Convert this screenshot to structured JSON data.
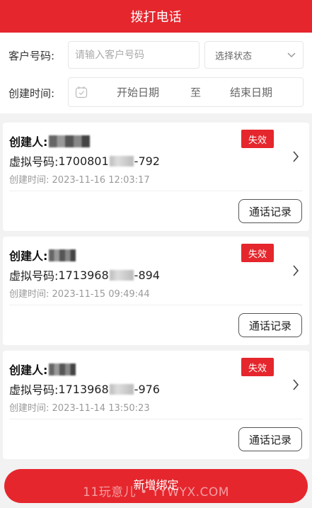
{
  "header": {
    "title": "拨打电话"
  },
  "filters": {
    "customer_label": "客户号码:",
    "customer_placeholder": "请输入客户号码",
    "status_select": "选择状态",
    "time_label": "创建时间:",
    "start_date": "开始日期",
    "date_separator": "至",
    "end_date": "结束日期"
  },
  "records": [
    {
      "creator_label": "创建人:",
      "status": "失效",
      "vnum_label": "虚拟号码:",
      "vnum_prefix": "1700801",
      "vnum_suffix": "-792",
      "time_label": "创建时间:",
      "created": "2023-11-16 12:03:17",
      "call_button": "通话记录"
    },
    {
      "creator_label": "创建人:",
      "status": "失效",
      "vnum_label": "虚拟号码:",
      "vnum_prefix": "1713968",
      "vnum_suffix": "-894",
      "time_label": "创建时间:",
      "created": "2023-11-15 09:49:44",
      "call_button": "通话记录"
    },
    {
      "creator_label": "创建人:",
      "status": "失效",
      "vnum_label": "虚拟号码:",
      "vnum_prefix": "1713968",
      "vnum_suffix": "-976",
      "time_label": "创建时间:",
      "created": "2023-11-14 13:50:23",
      "call_button": "通话记录"
    }
  ],
  "footer": {
    "button": "新增绑定"
  },
  "watermark": "11玩意儿 • YYWYX.COM",
  "colors": {
    "accent": "#e5262d"
  }
}
